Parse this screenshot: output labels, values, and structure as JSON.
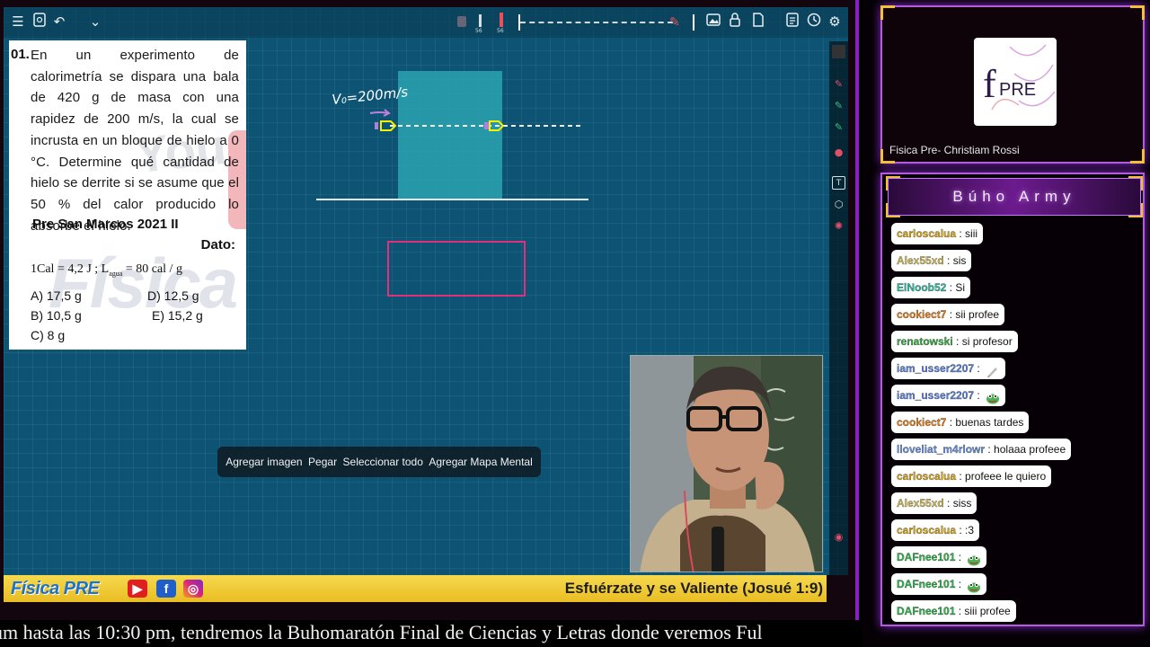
{
  "toolbar": {
    "icons": [
      "menu-icon",
      "file-icon",
      "undo-icon",
      "chevron-down-icon",
      "image-icon",
      "lock-icon",
      "page-icon",
      "export-icon",
      "timer-icon",
      "settings-icon"
    ],
    "pen_labels": [
      "56",
      "56"
    ]
  },
  "problem": {
    "number": "01.",
    "text": "En un experimento de calorimetría se dispara una bala de 420 g de masa con una rapidez de 200 m/s, la cual se incrusta en un bloque de hielo a 0 °C. Determine qué cantidad de hielo se derrite si se asume que el 50 % del calor producido lo absorbe el hielo.",
    "source": "Pre San Marcos 2021 II",
    "dato_label": "Dato:",
    "formula": "1Cal = 4,2 J ; L",
    "formula_sub": "agua",
    "formula_tail": " = 80 cal / g",
    "options": [
      {
        "label": "A) 17,5 g"
      },
      {
        "label": "D) 12,5 g"
      },
      {
        "label": "B) 10,5 g"
      },
      {
        "label": "E) 15,2 g"
      },
      {
        "label": "C) 8 g"
      }
    ],
    "watermark_yt": "You",
    "watermark_fisica": "Física"
  },
  "drawing": {
    "velocity_label": "V₀=200m/s",
    "block_color": "#2aa3b0",
    "box_color": "#e0307d"
  },
  "context_menu": {
    "items": [
      "Agregar imagen",
      "Pegar",
      "Seleccionar todo",
      "Agregar Mapa Mental"
    ]
  },
  "banner": {
    "logo": "Física PRE",
    "motto": "Esfuérzate y se Valiente (Josué 1:9)",
    "social": [
      "youtube-icon",
      "facebook-icon",
      "instagram-icon"
    ]
  },
  "ticker": {
    "text": "um hasta las 10:30 pm, tendremos la Buhomaratón Final de Ciencias y Letras donde veremos Ful"
  },
  "channel": {
    "logo_text": "PRE",
    "logo_letter": "f",
    "name": "Fisica Pre- Christiam Rossi"
  },
  "chat": {
    "title": "Búho Army",
    "messages": [
      {
        "user": "carloscalua",
        "text": ": siii",
        "color": "#d4a017"
      },
      {
        "user": "Alex55xd",
        "text": ": sis",
        "color": "#c9b458"
      },
      {
        "user": "ElNoob52",
        "text": ": Si",
        "color": "#2fb8a0"
      },
      {
        "user": "cookiect7",
        "text": ": sii profee",
        "color": "#e07b1a"
      },
      {
        "user": "renatowski",
        "text": ": si profesor",
        "color": "#3aa843"
      },
      {
        "user": "iam_usser2207",
        "text": ":",
        "color": "#5b7fd6",
        "emote": "pencil"
      },
      {
        "user": "iam_usser2207",
        "text": ":",
        "color": "#5b7fd6",
        "emote": "frog"
      },
      {
        "user": "cookiect7",
        "text": ": buenas tardes",
        "color": "#e07b1a"
      },
      {
        "user": "lloveliat_m4rlowr",
        "text": ": holaaa profeee",
        "color": "#6a8fd8"
      },
      {
        "user": "carloscalua",
        "text": ": profeee le quiero",
        "color": "#d4a017"
      },
      {
        "user": "Alex55xd",
        "text": ": siss",
        "color": "#c9b458"
      },
      {
        "user": "carloscalua",
        "text": ": :3",
        "color": "#d4a017"
      },
      {
        "user": "DAFnee101",
        "text": ":",
        "color": "#2fb04a",
        "emote": "frog"
      },
      {
        "user": "DAFnee101",
        "text": ":",
        "color": "#2fb04a",
        "emote": "frog"
      },
      {
        "user": "DAFnee101",
        "text": ": siii profee",
        "color": "#2fb04a"
      }
    ]
  }
}
